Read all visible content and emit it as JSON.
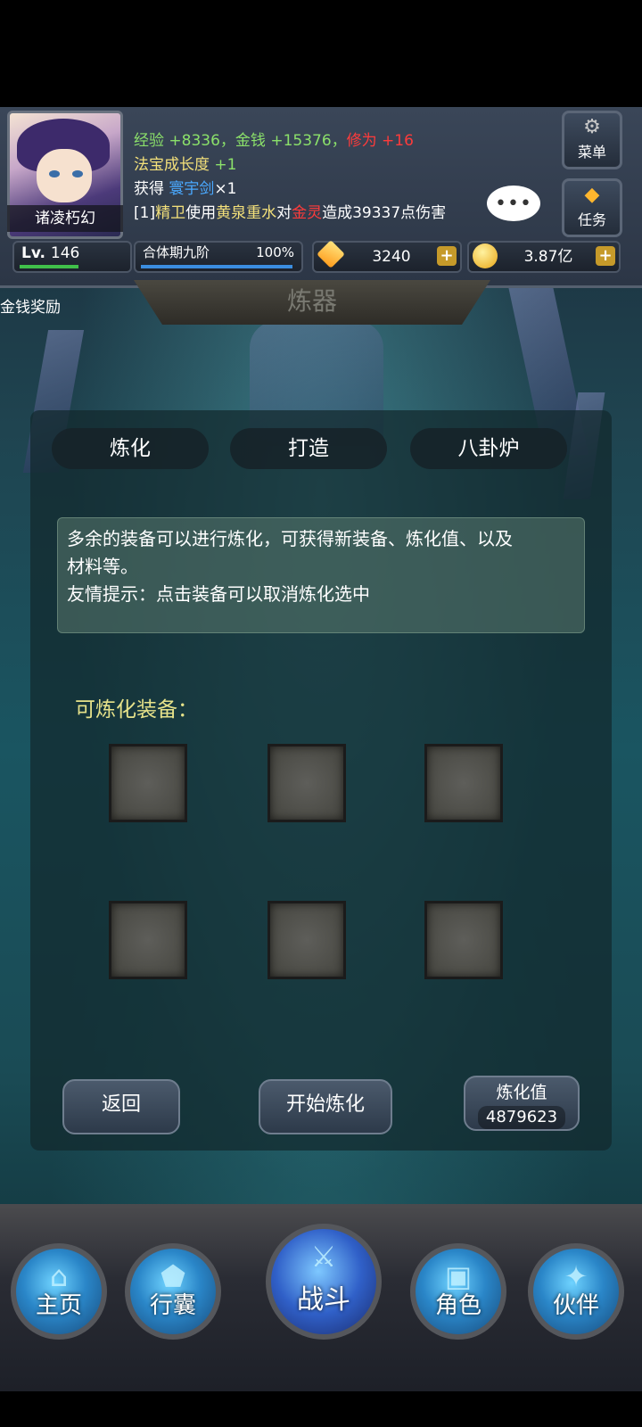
{
  "header": {
    "avatar_name": "诸凌朽幻",
    "log_lines": {
      "line1": [
        {
          "text": "经验 ",
          "color": "#8be06a"
        },
        {
          "text": "+8336",
          "color": "#8be06a"
        },
        {
          "text": "，金钱 ",
          "color": "#8be06a"
        },
        {
          "text": "+15376",
          "color": "#8be06a"
        },
        {
          "text": "，",
          "color": "#8be06a"
        },
        {
          "text": "修为 +16",
          "color": "#ff3b3b"
        }
      ],
      "line2_a": "法宝成长度",
      "line2_b": " +1",
      "line3_a": "获得 ",
      "line3_b": "寰宇剑",
      "line3_c": "×1",
      "line4_a": "[1]",
      "line4_b": "精卫",
      "line4_c": "使用",
      "line4_d": "黄泉重水",
      "line4_e": "对",
      "line4_f": "金灵",
      "line4_g": "造成39337点伤害"
    },
    "chat_bubble": "•••",
    "menu_label": "菜单",
    "task_label": "任务",
    "menu_icon": "gear-icon",
    "task_icon": "diamond-icon"
  },
  "resources": {
    "level_prefix": "Lv.",
    "level": "146",
    "level_progress": 0.6,
    "realm": "合体期九阶",
    "realm_percent": "100%",
    "realm_progress": 1.0,
    "gems": "3240",
    "gold": "3.87亿",
    "plus": "+"
  },
  "title": "炼器",
  "gold_reward": "金钱奖励",
  "tabs": [
    "炼化",
    "打造",
    "八卦炉"
  ],
  "info": {
    "line1": "多余的装备可以进行炼化，可获得新装备、炼化值、以及",
    "line2": "材料等。",
    "line3": "友情提示：点击装备可以取消炼化选中"
  },
  "equip_label": "可炼化装备：",
  "slots_count": 6,
  "buttons": {
    "back": "返回",
    "start": "开始炼化",
    "value_label": "炼化值",
    "value": "4879623"
  },
  "nav": {
    "home": "主页",
    "bag": "行囊",
    "battle": "战斗",
    "role": "角色",
    "partner": "伙伴"
  }
}
